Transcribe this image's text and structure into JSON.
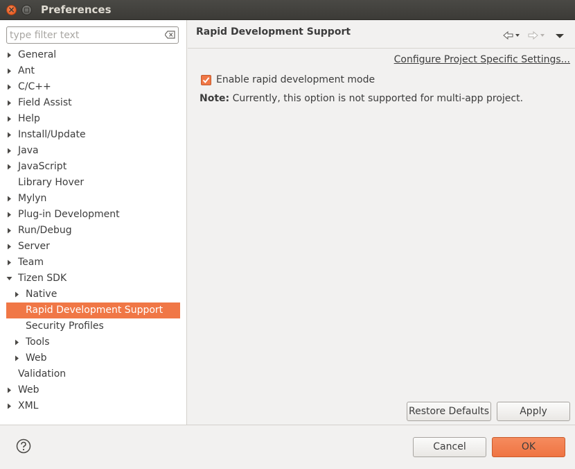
{
  "window": {
    "title": "Preferences",
    "close_glyph": "×"
  },
  "filter": {
    "placeholder": "type filter text",
    "value": ""
  },
  "tree": [
    {
      "label": "General",
      "expandable": true,
      "expanded": false,
      "level": 0
    },
    {
      "label": "Ant",
      "expandable": true,
      "expanded": false,
      "level": 0
    },
    {
      "label": "C/C++",
      "expandable": true,
      "expanded": false,
      "level": 0
    },
    {
      "label": "Field Assist",
      "expandable": true,
      "expanded": false,
      "level": 0
    },
    {
      "label": "Help",
      "expandable": true,
      "expanded": false,
      "level": 0
    },
    {
      "label": "Install/Update",
      "expandable": true,
      "expanded": false,
      "level": 0
    },
    {
      "label": "Java",
      "expandable": true,
      "expanded": false,
      "level": 0
    },
    {
      "label": "JavaScript",
      "expandable": true,
      "expanded": false,
      "level": 0
    },
    {
      "label": "Library Hover",
      "expandable": false,
      "expanded": false,
      "level": 0
    },
    {
      "label": "Mylyn",
      "expandable": true,
      "expanded": false,
      "level": 0
    },
    {
      "label": "Plug-in Development",
      "expandable": true,
      "expanded": false,
      "level": 0
    },
    {
      "label": "Run/Debug",
      "expandable": true,
      "expanded": false,
      "level": 0
    },
    {
      "label": "Server",
      "expandable": true,
      "expanded": false,
      "level": 0
    },
    {
      "label": "Team",
      "expandable": true,
      "expanded": false,
      "level": 0
    },
    {
      "label": "Tizen SDK",
      "expandable": true,
      "expanded": true,
      "level": 0
    },
    {
      "label": "Native",
      "expandable": true,
      "expanded": false,
      "level": 1
    },
    {
      "label": "Rapid Development Support",
      "expandable": false,
      "expanded": false,
      "level": 1,
      "selected": true
    },
    {
      "label": "Security Profiles",
      "expandable": false,
      "expanded": false,
      "level": 1
    },
    {
      "label": "Tools",
      "expandable": true,
      "expanded": false,
      "level": 1
    },
    {
      "label": "Web",
      "expandable": true,
      "expanded": false,
      "level": 1
    },
    {
      "label": "Validation",
      "expandable": false,
      "expanded": false,
      "level": 0
    },
    {
      "label": "Web",
      "expandable": true,
      "expanded": false,
      "level": 0
    },
    {
      "label": "XML",
      "expandable": true,
      "expanded": false,
      "level": 0
    }
  ],
  "page": {
    "title": "Rapid Development Support",
    "configure_link": "Configure Project Specific Settings...",
    "enable_checkbox": {
      "label": "Enable rapid development mode",
      "checked": true
    },
    "note_label": "Note:",
    "note_text": " Currently, this option is not supported for multi-app project."
  },
  "buttons": {
    "restore_defaults": "Restore Defaults",
    "apply": "Apply",
    "cancel": "Cancel",
    "ok": "OK"
  },
  "icons": {
    "back": "back-arrow-icon",
    "forward": "forward-arrow-icon",
    "menu": "view-menu-icon",
    "help": "help-icon",
    "clear": "clear-filter-icon"
  },
  "colors": {
    "accent": "#f07746",
    "titlebar": "#3c3b37"
  }
}
